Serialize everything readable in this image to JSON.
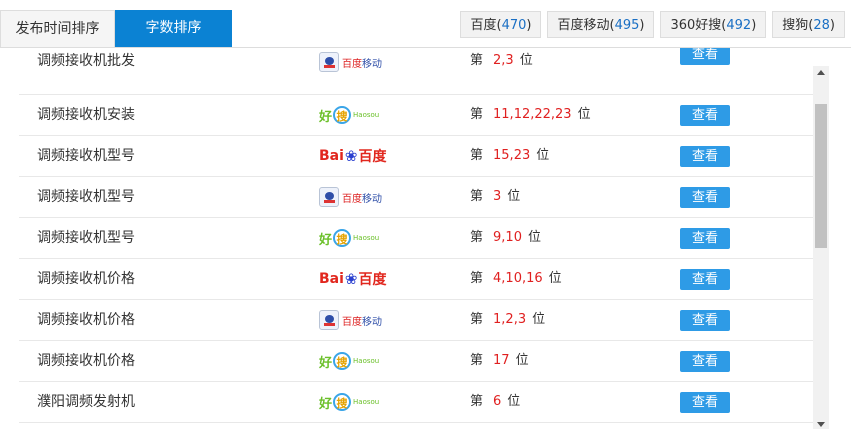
{
  "tabs": [
    {
      "label": "发布时间排序",
      "active": false
    },
    {
      "label": "字数排序",
      "active": true
    }
  ],
  "filters": [
    {
      "name": "百度",
      "count": "470"
    },
    {
      "name": "百度移动",
      "count": "495"
    },
    {
      "name": "360好搜",
      "count": "492"
    },
    {
      "name": "搜狗",
      "count": "28"
    }
  ],
  "logos": {
    "baidu_mobile": {
      "a": "百度",
      "b": "移动"
    },
    "haosou": {
      "a": "好",
      "b": "搜",
      "en": "Haosou"
    },
    "baidu": {
      "a": "Bai",
      "b": "百度"
    }
  },
  "rank_prefix": "第",
  "rank_suffix": "位",
  "view_label": "查看",
  "rows": [
    {
      "keyword": "调频接收机批发",
      "engine": "baidu_mobile",
      "positions": "2,3"
    },
    {
      "keyword": "调频接收机安装",
      "engine": "haosou",
      "positions": "11,12,22,23"
    },
    {
      "keyword": "调频接收机型号",
      "engine": "baidu",
      "positions": "15,23"
    },
    {
      "keyword": "调频接收机型号",
      "engine": "baidu_mobile",
      "positions": "3"
    },
    {
      "keyword": "调频接收机型号",
      "engine": "haosou",
      "positions": "9,10"
    },
    {
      "keyword": "调频接收机价格",
      "engine": "baidu",
      "positions": "4,10,16"
    },
    {
      "keyword": "调频接收机价格",
      "engine": "baidu_mobile",
      "positions": "1,2,3"
    },
    {
      "keyword": "调频接收机价格",
      "engine": "haosou",
      "positions": "17"
    },
    {
      "keyword": "濮阳调频发射机",
      "engine": "haosou",
      "positions": "6"
    }
  ]
}
